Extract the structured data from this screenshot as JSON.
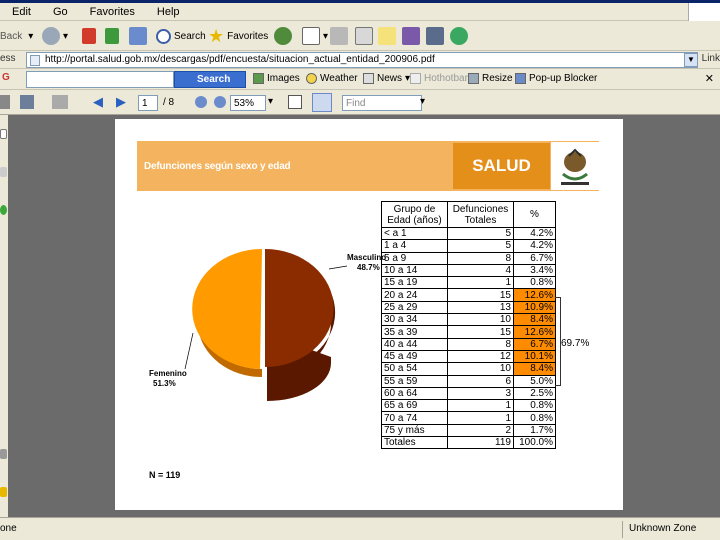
{
  "menu": [
    "Edit",
    "Go",
    "Favorites",
    "Help"
  ],
  "toolbar": {
    "back_label": "Back",
    "search_label": "Search",
    "favorites_label": "Favorites"
  },
  "address": {
    "label": "ess",
    "url": "http://portal.salud.gob.mx/descargas/pdf/encuesta/situacion_actual_entidad_200906.pdf",
    "links_label": "Link"
  },
  "googlebar": {
    "search_label": "Search",
    "items": [
      "Images",
      "Weather",
      "News",
      "Hothotbar",
      "Resize",
      "Pop-up Blocker"
    ]
  },
  "pdfbar": {
    "page_current": "1",
    "page_total": "/ 8",
    "zoom": "53%",
    "find_placeholder": "Find"
  },
  "slide": {
    "title": "Defunciones según sexo y edad",
    "brand": "SALUD",
    "pie": {
      "masc_label": "Masculino",
      "masc_value": "48.7%",
      "fem_label": "Femenino",
      "fem_value": "51.3%"
    },
    "n_label": "N = 119",
    "bracket_label": "69.7%",
    "table": {
      "headers": [
        "Grupo de Edad (años)",
        "Defunciones Totales",
        "%"
      ],
      "rows": [
        {
          "group": "< a 1",
          "count": "5",
          "pct": "4.2%"
        },
        {
          "group": "1 a 4",
          "count": "5",
          "pct": "4.2%"
        },
        {
          "group": "5 a 9",
          "count": "8",
          "pct": "6.7%"
        },
        {
          "group": "10 a 14",
          "count": "4",
          "pct": "3.4%"
        },
        {
          "group": "15 a 19",
          "count": "1",
          "pct": "0.8%"
        },
        {
          "group": "20 a 24",
          "count": "15",
          "pct": "12.6%"
        },
        {
          "group": "25 a 29",
          "count": "13",
          "pct": "10.9%"
        },
        {
          "group": "30 a 34",
          "count": "10",
          "pct": "8.4%"
        },
        {
          "group": "35 a 39",
          "count": "15",
          "pct": "12.6%"
        },
        {
          "group": "40 a 44",
          "count": "8",
          "pct": "6.7%"
        },
        {
          "group": "45 a 49",
          "count": "12",
          "pct": "10.1%"
        },
        {
          "group": "50 a 54",
          "count": "10",
          "pct": "8.4%"
        },
        {
          "group": "55 a 59",
          "count": "6",
          "pct": "5.0%"
        },
        {
          "group": "60 a 64",
          "count": "3",
          "pct": "2.5%"
        },
        {
          "group": "65 a 69",
          "count": "1",
          "pct": "0.8%"
        },
        {
          "group": "70 a 74",
          "count": "1",
          "pct": "0.8%"
        },
        {
          "group": "75 y más",
          "count": "2",
          "pct": "1.7%"
        },
        {
          "group": "Totales",
          "count": "119",
          "pct": "100.0%"
        }
      ]
    }
  },
  "status": {
    "left": "one",
    "zone": "Unknown Zone"
  },
  "colors": {
    "banner": "#f4b35e",
    "brand_box": "#e48f1a",
    "highlight": "#ff8c00",
    "pie_masc": "#8b2c00",
    "pie_fem": "#ff9a00"
  }
}
